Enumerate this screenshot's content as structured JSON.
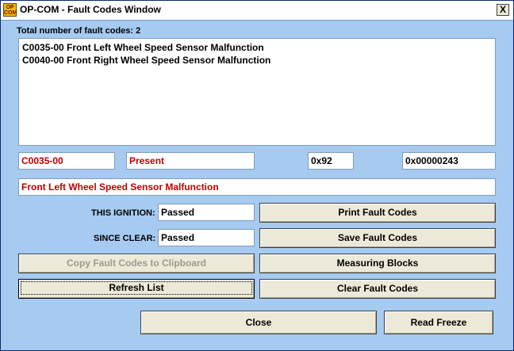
{
  "window": {
    "title": "OP-COM - Fault Codes Window",
    "icon_text": "OP COM",
    "close_label": "X"
  },
  "summary": {
    "total_label": "Total number of fault codes:",
    "total_value": "2"
  },
  "fault_list": [
    "C0035-00 Front Left Wheel Speed Sensor Malfunction",
    "C0040-00 Front Right Wheel Speed Sensor Malfunction"
  ],
  "detail": {
    "code": "C0035-00",
    "status": "Present",
    "hex1": "0x92",
    "hex2": "0x00000243",
    "description": "Front Left Wheel Speed Sensor Malfunction"
  },
  "tests": {
    "this_ignition_label": "THIS IGNITION:",
    "this_ignition_value": "Passed",
    "since_clear_label": "SINCE CLEAR:",
    "since_clear_value": "Passed"
  },
  "buttons": {
    "print": "Print Fault Codes",
    "save": "Save Fault Codes",
    "copy": "Copy Fault Codes to Clipboard",
    "measuring": "Measuring Blocks",
    "refresh": "Refresh List",
    "clear": "Clear Fault Codes",
    "close": "Close",
    "read_freeze": "Read Freeze"
  },
  "colors": {
    "window_bg": "#a6caf0",
    "error_text": "#c00000"
  }
}
